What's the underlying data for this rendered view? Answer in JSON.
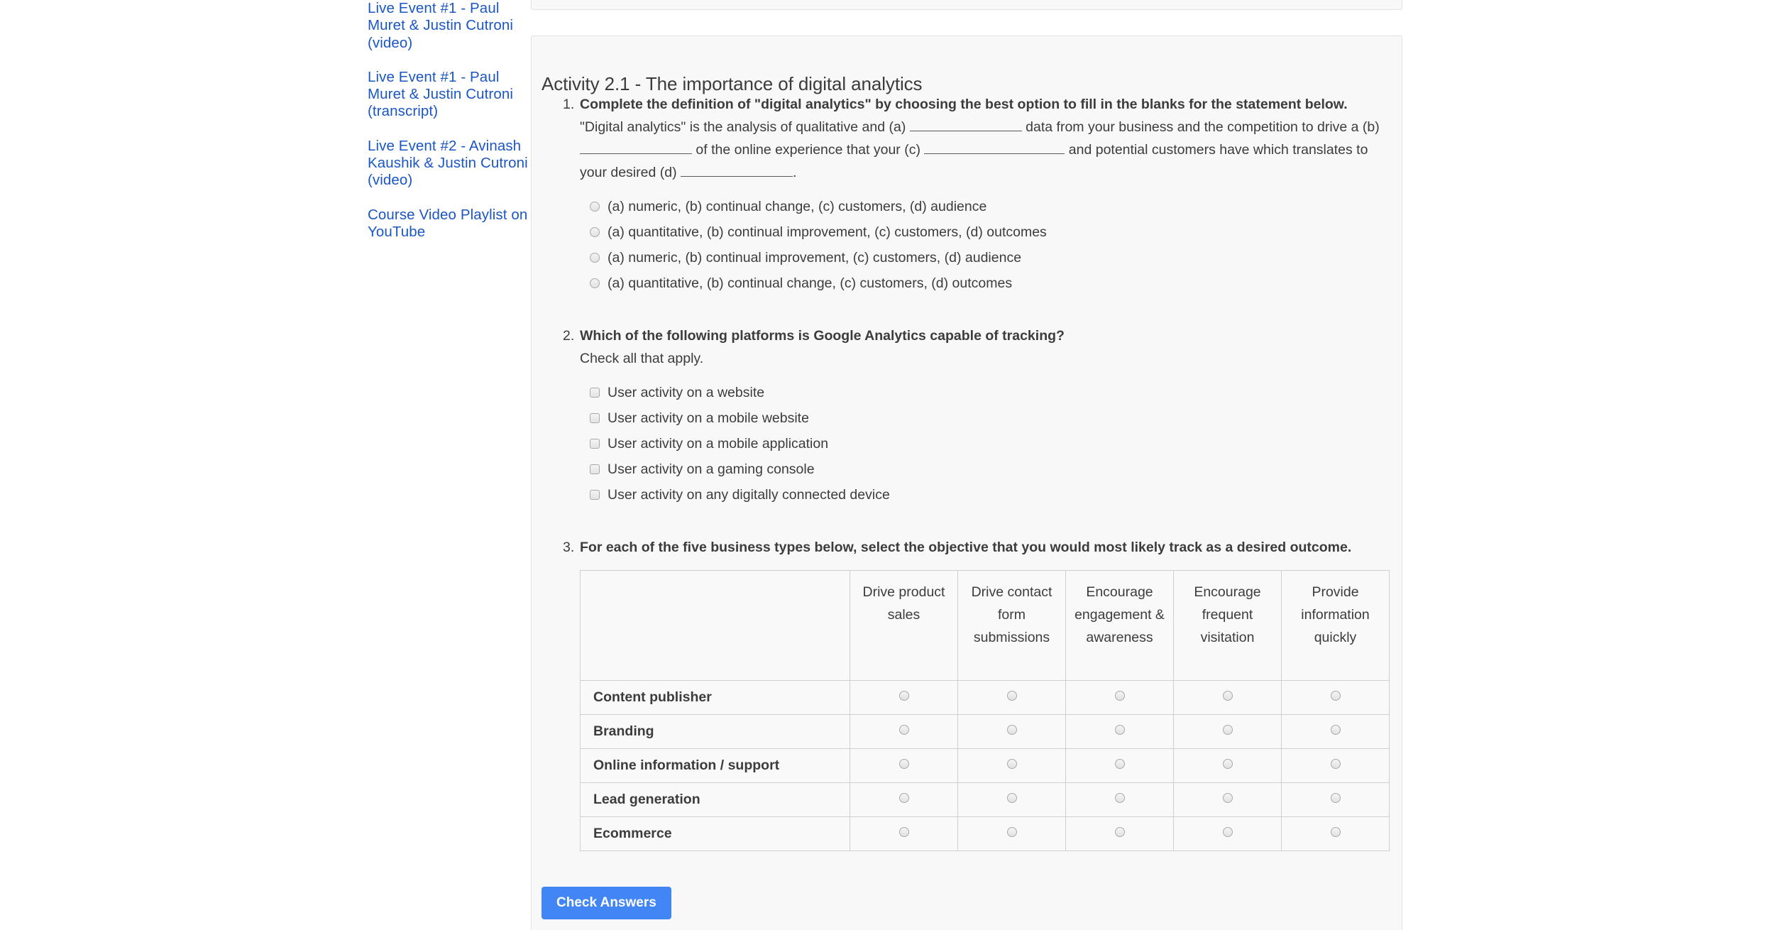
{
  "sidebar": {
    "links": [
      "Live Event #1 - Paul Muret & Justin Cutroni (video)",
      "Live Event #1 - Paul Muret & Justin Cutroni (transcript)",
      "Live Event #2 - Avinash Kaushik & Justin Cutroni (video)",
      "Course Video Playlist on YouTube"
    ]
  },
  "activity": {
    "title": "Activity 2.1 - The importance of digital analytics",
    "accent_color": "#4285f4",
    "link_color": "#1a56c4",
    "text_color": "#3c3c3c",
    "panel_bg": "#f8f8f8",
    "q1": {
      "number": "1.",
      "prompt": "Complete the definition of \"digital analytics\" by choosing the best option to fill in the blanks for the statement below.",
      "body_part1": "\"Digital analytics\" is the analysis of qualitative and (a)",
      "body_part2": "data from your business and the competition to drive a (b)",
      "body_part3": "of the online experience that your (c)",
      "body_part4": "and potential customers have which translates to your desired (d)",
      "body_part5": ".",
      "options": [
        "(a) numeric, (b) continual change, (c) customers, (d) audience",
        "(a) quantitative, (b) continual improvement, (c) customers, (d) outcomes",
        "(a) numeric, (b) continual improvement, (c) customers, (d) audience",
        "(a) quantitative, (b) continual change, (c) customers, (d) outcomes"
      ]
    },
    "q2": {
      "number": "2.",
      "prompt": "Which of the following platforms is Google Analytics capable of tracking?",
      "subprompt": "Check all that apply.",
      "options": [
        "User activity on a website",
        "User activity on a mobile website",
        "User activity on a mobile application",
        "User activity on a gaming console",
        "User activity on any digitally connected device"
      ]
    },
    "q3": {
      "number": "3.",
      "prompt": "For each of the five business types below, select the objective that you would most likely track as a desired outcome.",
      "matrix": {
        "corner_header": "",
        "columns": [
          "Drive product sales",
          "Drive contact form submissions",
          "Encourage engagement & awareness",
          "Encourage frequent visitation",
          "Provide information quickly"
        ],
        "rows": [
          "Content publisher",
          "Branding",
          "Online information / support",
          "Lead generation",
          "Ecommerce"
        ]
      }
    },
    "check_button": "Check Answers"
  }
}
